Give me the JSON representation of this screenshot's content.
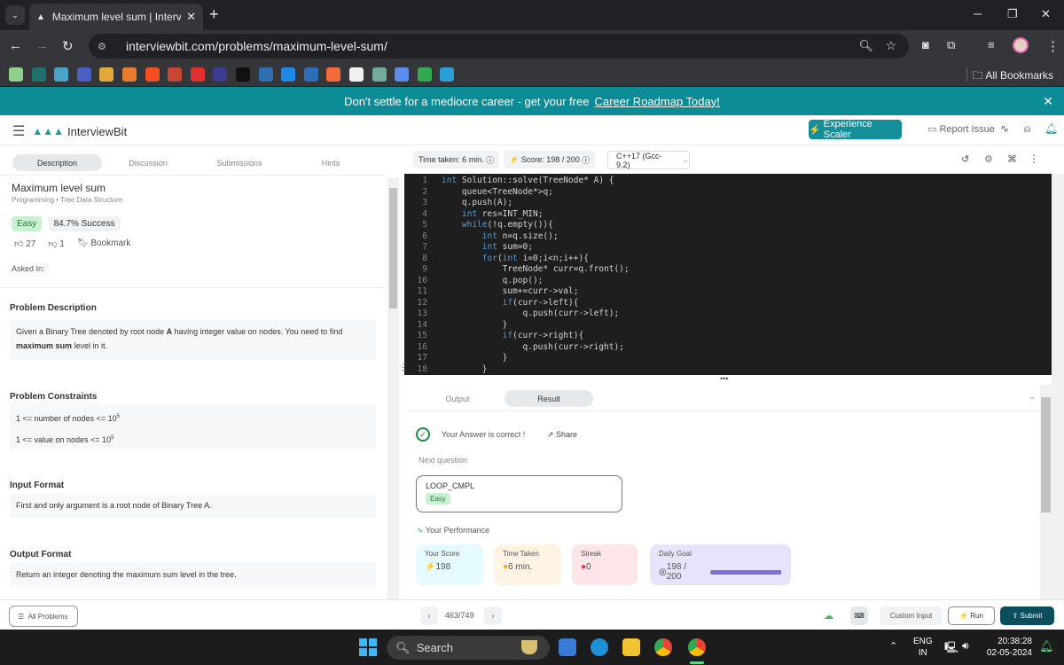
{
  "browser": {
    "tab_title": "Maximum level sum | InterviewBit",
    "url": "interviewbit.com/problems/maximum-level-sum/",
    "all_bookmarks": "All Bookmarks",
    "bookmark_icons": [
      "octopus-icon",
      "c-icon",
      "arch-icon",
      "window-icon",
      "puzzle-icon",
      "gift-icon",
      "microsoft-icon",
      "oracle-ring-icon",
      "oracle-icon",
      "aws-icon",
      "aws-dark-icon",
      "l-icon",
      "power-icon",
      "s-icon",
      "swirl-icon",
      "interviewbit-icon",
      "chatgpt-icon",
      "gemini-icon",
      "play-icon",
      "image-icon"
    ],
    "bookmark_colors": [
      "#8fd18a",
      "#1f6f6a",
      "#4aa3c9",
      "#4a5fc1",
      "#e5a83b",
      "#e87c2f",
      "#f25022",
      "#c74634",
      "#e02f2f",
      "#3b3b8f",
      "#111111",
      "#2f6fb0",
      "#1e88e5",
      "#2a6fb6",
      "#f26b38",
      "#f0f0f0",
      "#74aa9c",
      "#5b8def",
      "#34a853",
      "#2a9fd8"
    ]
  },
  "banner": {
    "text": "Don't settle for a mediocre career - get your free",
    "link": "Career Roadmap Today!"
  },
  "header": {
    "logo_text": "InterviewBit",
    "scaler_button": "Experience Scaler",
    "report_issue": "Report Issue"
  },
  "left_tabs": [
    "Description",
    "Discussion",
    "Submissions",
    "Hints"
  ],
  "problem": {
    "title": "Maximum level sum",
    "category": "Programming",
    "topic": "Tree Data Structure",
    "difficulty": "Easy",
    "success": "84.7% Success",
    "likes": "27",
    "dislikes": "1",
    "bookmark": "Bookmark",
    "asked_in": "Asked In:",
    "desc_heading": "Problem Description",
    "desc_pre": "Given a Binary Tree denoted by root node ",
    "desc_a": "A",
    "desc_mid": " having integer value on nodes. You need to find ",
    "desc_bold": "maximum sum",
    "desc_post": " level in it.",
    "constraints_heading": "Problem Constraints",
    "constraint1": "1 <= number of nodes <= 10",
    "constraint2": "1 <= value on nodes <= 10",
    "exp": "5",
    "input_heading": "Input Format",
    "input_text": "First and only argument is a root node of Binary Tree A.",
    "output_heading": "Output Format",
    "output_text": "Return an integer denoting the maximum sum level in the tree."
  },
  "editor": {
    "time_taken": "Time taken: 6 min.",
    "score": "Score: 198 / 200",
    "language": "C++17 (Gcc-9.2)",
    "code": [
      "int Solution::solve(TreeNode* A) {",
      "    queue<TreeNode*>q;",
      "    q.push(A);",
      "    int res=INT_MIN;",
      "    while(!q.empty()){",
      "        int n=q.size();",
      "        int sum=0;",
      "        for(int i=0;i<n;i++){",
      "            TreeNode* curr=q.front();",
      "            q.pop();",
      "            sum+=curr->val;",
      "            if(curr->left){",
      "                q.push(curr->left);",
      "            }",
      "            if(curr->right){",
      "                q.push(curr->right);",
      "            }",
      "        }"
    ]
  },
  "result": {
    "tabs": [
      "Output",
      "Result"
    ],
    "correct": "Your Answer is correct !",
    "share": "Share",
    "next_label": "Next question",
    "next_title": "LOOP_CMPL",
    "next_difficulty": "Easy",
    "performance": "Your Performance",
    "cards": [
      {
        "label": "Your Score",
        "value": "198",
        "color": "#e6fbfd",
        "icon": "⚡",
        "icon_color": "#18b5c4"
      },
      {
        "label": "Time Taken",
        "value": "6 min.",
        "color": "#fef4e4",
        "icon": "●",
        "icon_color": "#f5a623"
      },
      {
        "label": "Streak",
        "value": "0",
        "color": "#fde5e8",
        "icon": "●",
        "icon_color": "#e8334a"
      },
      {
        "label": "Daily Goal",
        "value": "198 / 200",
        "color": "#e6e4fa",
        "icon": "◎",
        "icon_color": "#333"
      }
    ],
    "daily_goal_progress": 0.99
  },
  "footer": {
    "all_problems": "All Problems",
    "pager": "463/749",
    "custom_input": "Custom Input",
    "run": "Run",
    "submit": "Submit"
  },
  "taskbar": {
    "search": "Search",
    "lang1": "ENG",
    "lang2": "IN",
    "time": "20:38:28",
    "date": "02-05-2024"
  }
}
